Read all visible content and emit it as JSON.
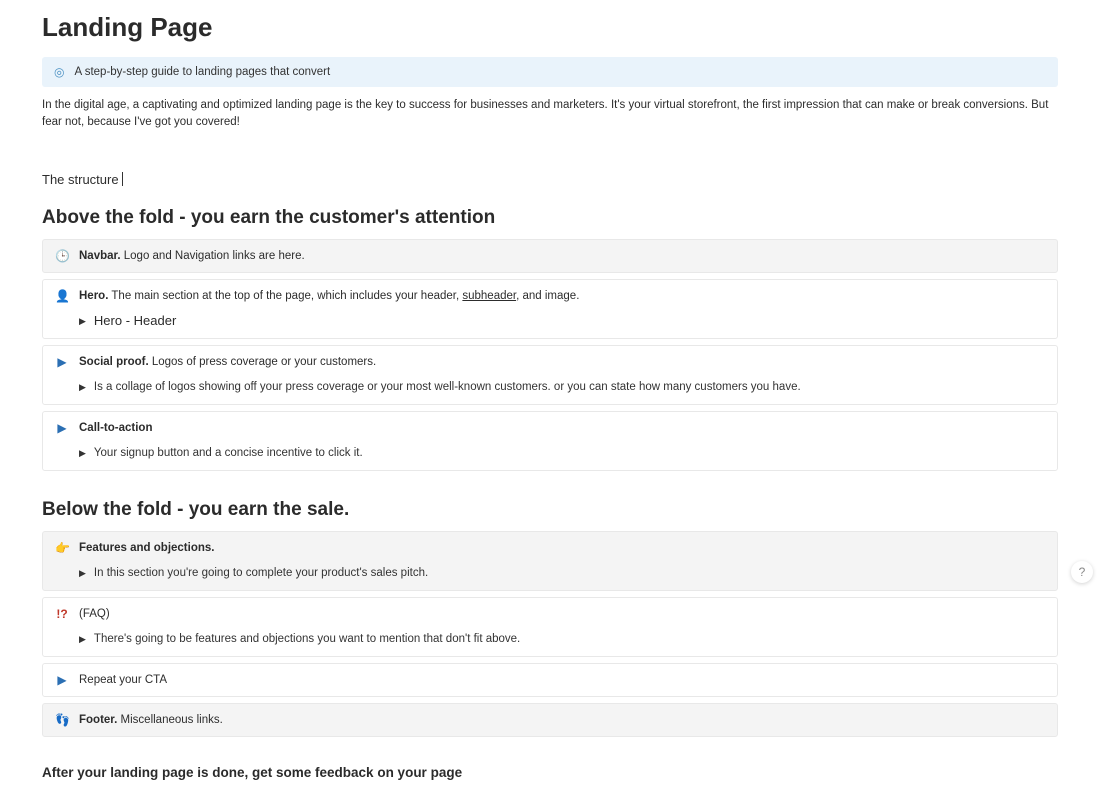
{
  "title": "Landing Page",
  "callout": {
    "icon": "◎",
    "text": "A step-by-step guide to landing pages that convert"
  },
  "intro": "In the digital age, a captivating and optimized landing page is the key to success for businesses and marketers. It's your virtual storefront, the first impression that can make or break conversions. But fear not, because I've got you covered!",
  "structure_label": "The structure",
  "sections": {
    "above": {
      "heading": "Above the fold - you earn the customer's attention",
      "blocks": [
        {
          "icon": "🕒",
          "icon_class": "ico-clock",
          "shaded": true,
          "bold": "Navbar.",
          "rest": " Logo and Navigation links are here."
        },
        {
          "icon": "👤",
          "icon_class": "ico-person",
          "shaded": false,
          "bold": "Hero.",
          "rest_pre": " The main section at the top of the page, which includes your header, ",
          "rest_link": "subheader",
          "rest_post": ", and image.",
          "sub_hero": "Hero - Header"
        },
        {
          "icon": "▶",
          "icon_class": "ico-play",
          "shaded": false,
          "bold": "Social proof.",
          "rest": " Logos of press coverage or your customers.",
          "sub": "Is a collage of logos showing off your press coverage or your most well-known customers. or you can state how many customers you have."
        },
        {
          "icon": "▶",
          "icon_class": "ico-play",
          "shaded": false,
          "bold": "Call-to-action",
          "rest": "",
          "sub": "Your signup button and a concise incentive to click it."
        }
      ]
    },
    "below": {
      "heading": "Below the fold - you earn the sale.",
      "blocks": [
        {
          "icon": "👉",
          "icon_class": "ico-pointer",
          "shaded": true,
          "bold": "Features and objections.",
          "rest": "",
          "sub": "In this section you're going to complete your product's sales pitch."
        },
        {
          "icon": "!?",
          "icon_class": "ico-faq",
          "shaded": false,
          "bold": "",
          "rest": "(FAQ)",
          "sub": "There's going to be features and objections you want to mention that don't fit above."
        },
        {
          "icon": "▶",
          "icon_class": "ico-play",
          "shaded": false,
          "bold": "",
          "rest": "Repeat your CTA"
        },
        {
          "icon": "👣",
          "icon_class": "ico-foot",
          "shaded": true,
          "bold": "Footer.",
          "rest": " Miscellaneous links."
        }
      ]
    }
  },
  "after_heading": "After your landing page is done, get some feedback on your page",
  "help_label": "?"
}
